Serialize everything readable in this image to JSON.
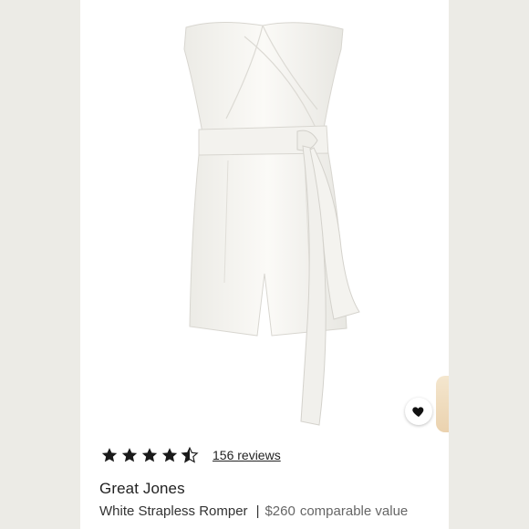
{
  "listing": {
    "rating": {
      "value": 4.5,
      "max": 5,
      "reviews_text": "156 reviews"
    },
    "brand": "Great Jones",
    "title": "White Strapless Romper",
    "separator": "|",
    "price": "$260",
    "price_suffix": "comparable value"
  },
  "icons": {
    "favorite": "heart-icon",
    "star": "star-icon"
  },
  "colors": {
    "background": "#ffffff",
    "side_band": "#ecebe6",
    "star": "#1a1a1a",
    "garment": "#f7f6f2"
  }
}
